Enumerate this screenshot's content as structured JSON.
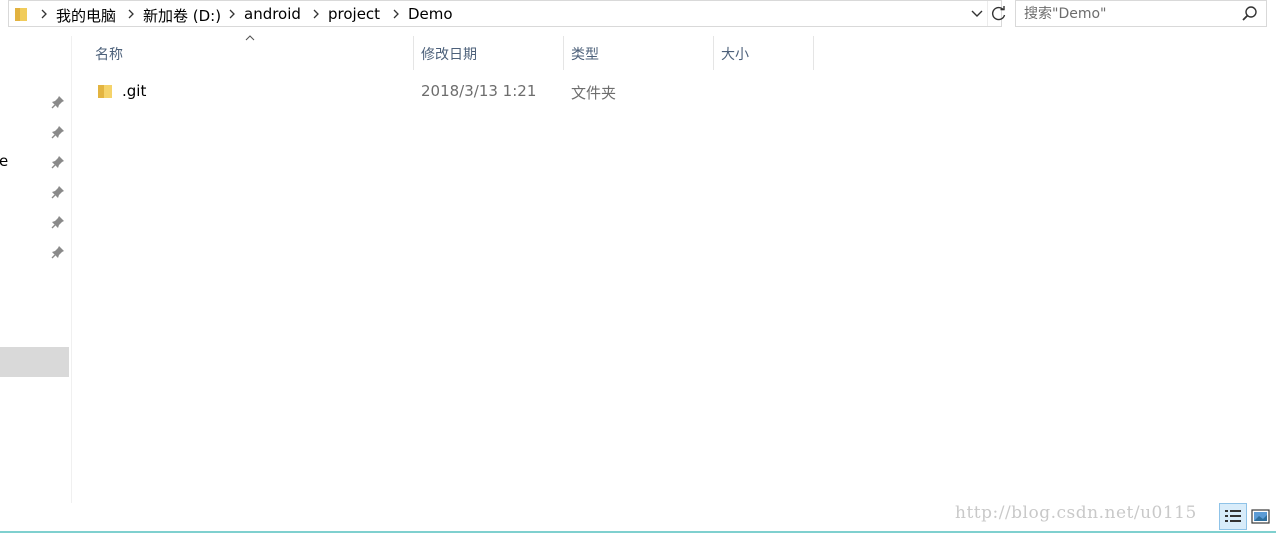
{
  "address_bar": {
    "breadcrumbs": [
      "我的电脑",
      "新加卷 (D:)",
      "android",
      "project",
      "Demo"
    ]
  },
  "search": {
    "placeholder": "搜索\"Demo\""
  },
  "nav": {
    "truncated_label": "e"
  },
  "columns": {
    "name": "名称",
    "date_modified": "修改日期",
    "type": "类型",
    "size": "大小"
  },
  "files": [
    {
      "name": ".git",
      "date_modified": "2018/3/13 1:21",
      "type": "文件夹",
      "size": ""
    }
  ],
  "watermark": "http://blog.csdn.net/u0115",
  "colors": {
    "accent": "#7fd0cf",
    "header_text": "#4c607a",
    "folder": "#e8c25a"
  }
}
